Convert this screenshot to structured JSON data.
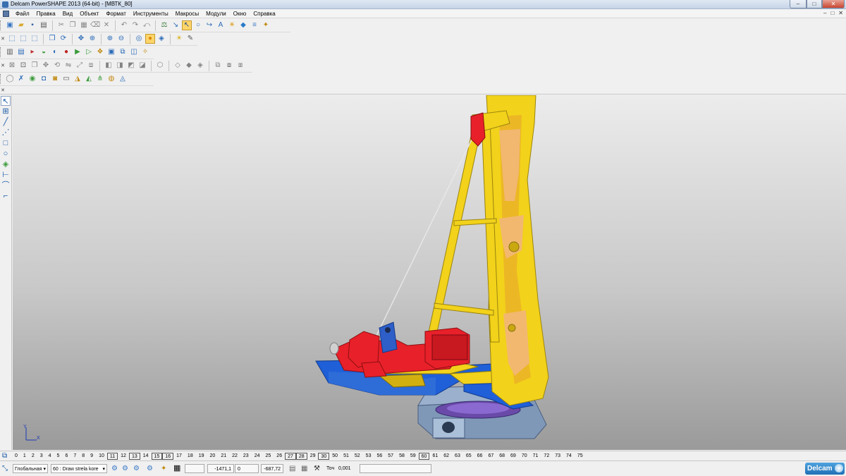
{
  "window": {
    "title": "Delcam PowerSHAPE 2013 (64-bit) - [МВТК_80]",
    "min": "–",
    "max": "□",
    "close": "✕"
  },
  "mdi_controls": [
    "–",
    "□",
    "✕"
  ],
  "menu": [
    "Файл",
    "Правка",
    "Вид",
    "Объект",
    "Формат",
    "Инструменты",
    "Макросы",
    "Модули",
    "Окно",
    "Справка"
  ],
  "levels": {
    "icon": "layers-icon",
    "items": [
      "0",
      "1",
      "2",
      "3",
      "4",
      "5",
      "6",
      "7",
      "8",
      "9",
      "10",
      "11",
      "12",
      "13",
      "14",
      "15",
      "16",
      "17",
      "18",
      "19",
      "20",
      "21",
      "22",
      "23",
      "24",
      "25",
      "26",
      "27",
      "28",
      "29",
      "30",
      "50",
      "51",
      "52",
      "53",
      "56",
      "57",
      "58",
      "59",
      "60",
      "61",
      "62",
      "63",
      "65",
      "66",
      "67",
      "68",
      "69",
      "70",
      "71",
      "72",
      "73",
      "74",
      "75"
    ],
    "boxed": [
      "11",
      "13",
      "15",
      "16",
      "27",
      "28",
      "30",
      "60"
    ]
  },
  "status": {
    "workplane": "Глобальная",
    "level": "60 : Draw strela kore",
    "x": "-1471,1",
    "y": "0",
    "z": "-687,72",
    "tolerance_label": "Точ",
    "tolerance": "0,001",
    "brand": "Delcam"
  },
  "axis": {
    "y_label": "Y",
    "x_label": "X"
  },
  "colors": {
    "viewport_top": "#ececec",
    "viewport_bottom": "#9a9a9a",
    "model_yellow": "#f2d21a",
    "model_orange": "#f2b870",
    "model_red": "#e8202a",
    "model_blue": "#1f5fd8",
    "model_steel": "#7f98b8",
    "brand_blue": "#2a7fc8"
  }
}
